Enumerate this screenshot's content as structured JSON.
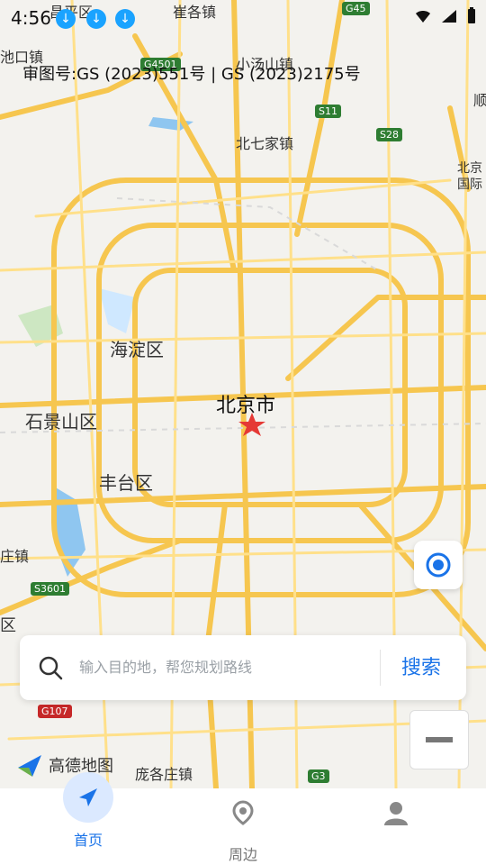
{
  "status": {
    "time": "4:56",
    "download_icon": "download-icon",
    "wifi_icon": "wifi-icon",
    "signal_icon": "signal-icon",
    "battery_icon": "battery-icon"
  },
  "map": {
    "review_text": "审图号:GS (2023)551号 | GS (2023)2175号",
    "city_label": "北京市",
    "labels": [
      {
        "id": "map-label-haidian",
        "text": "海淀区"
      },
      {
        "id": "map-label-shijingshan",
        "text": "石景山区"
      },
      {
        "id": "map-label-fengtai",
        "text": "丰台区"
      },
      {
        "id": "map-label-beiqijia",
        "text": "北七家镇"
      },
      {
        "id": "map-label-xiaotangshan",
        "text": "小汤山镇"
      },
      {
        "id": "map-label-cuigezhuang",
        "text": "崔各镇"
      },
      {
        "id": "map-label-chikou",
        "text": "池口镇"
      },
      {
        "id": "map-label-panggezhuang",
        "text": "庞各庄镇"
      },
      {
        "id": "map-label-beijing-airport",
        "text": "北京国际"
      },
      {
        "id": "map-label-changping",
        "text": "昌平区"
      },
      {
        "id": "map-label-zhuangzhen",
        "text": "庄镇"
      },
      {
        "id": "map-label-qu",
        "text": "区"
      },
      {
        "id": "map-label-shun",
        "text": "顺"
      }
    ],
    "road_shields": [
      {
        "id": "shield-g4501",
        "text": "G4501"
      },
      {
        "id": "shield-s11",
        "text": "S11"
      },
      {
        "id": "shield-s28",
        "text": "S28"
      },
      {
        "id": "shield-g45",
        "text": "G45"
      },
      {
        "id": "shield-s3601",
        "text": "S3601"
      },
      {
        "id": "shield-g107",
        "text": "G107"
      },
      {
        "id": "shield-g3",
        "text": "G3"
      }
    ],
    "colors": {
      "road_major": "#f6c64f",
      "road_minor": "#ffe08a",
      "water": "#8fc6f0",
      "green": "#cde7c2"
    }
  },
  "controls": {
    "locate_icon": "locate-icon",
    "zoom_out_icon": "minus-icon"
  },
  "search": {
    "placeholder": "输入目的地，帮您规划路线",
    "button_label": "搜索"
  },
  "logo": {
    "text": "高德地图"
  },
  "nav": {
    "items": [
      {
        "label": "首页",
        "icon": "navigation-icon",
        "active": true
      },
      {
        "label": "周边",
        "icon": "nearby-icon",
        "active": false
      },
      {
        "label": "",
        "icon": "profile-icon",
        "active": false
      }
    ]
  }
}
